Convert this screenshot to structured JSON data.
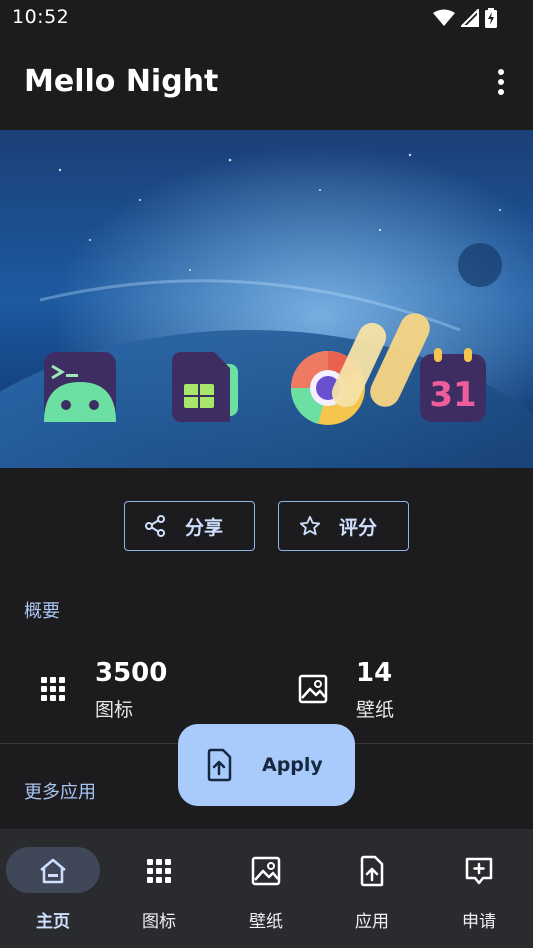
{
  "status_bar": {
    "time": "10:52"
  },
  "app_bar": {
    "title": "Mello Night"
  },
  "actions": {
    "share_label": "分享",
    "rate_label": "评分"
  },
  "overview": {
    "heading": "概要",
    "stats": [
      {
        "value": "3500",
        "caption": "图标"
      },
      {
        "value": "14",
        "caption": "壁纸"
      }
    ]
  },
  "more_apps": {
    "heading": "更多应用"
  },
  "fab": {
    "label": "Apply"
  },
  "hero": {
    "calendar_day": "31"
  },
  "bottom_nav": {
    "items": [
      {
        "label": "主页",
        "icon": "home-icon",
        "active": true
      },
      {
        "label": "图标",
        "icon": "grid-icon",
        "active": false
      },
      {
        "label": "壁纸",
        "icon": "image-icon",
        "active": false
      },
      {
        "label": "应用",
        "icon": "apply-icon",
        "active": false
      },
      {
        "label": "申请",
        "icon": "request-icon",
        "active": false
      }
    ]
  },
  "colors": {
    "accent": "#a9cbfb",
    "background": "#1c1c1e",
    "nav_background": "#2a2b2f"
  }
}
